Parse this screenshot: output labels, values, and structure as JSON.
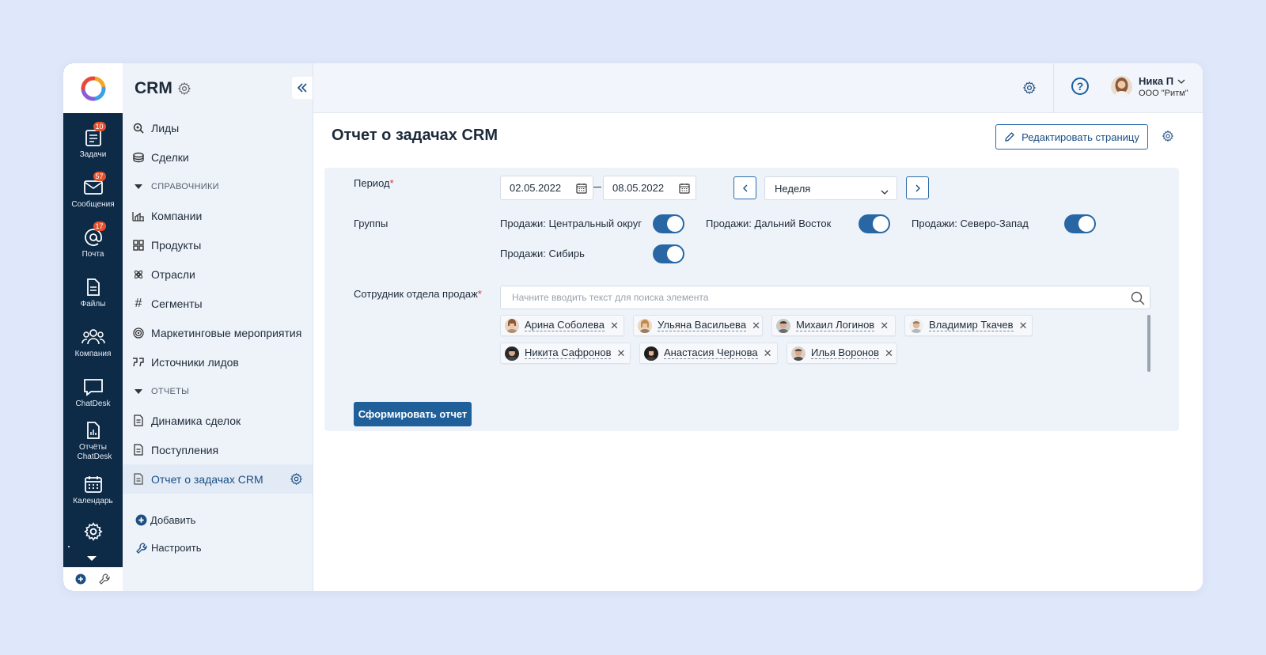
{
  "rail": {
    "items": [
      {
        "label": "Задачи",
        "icon": "tasks-icon",
        "badge": "10"
      },
      {
        "label": "Сообщения",
        "icon": "messages-icon",
        "badge": "57"
      },
      {
        "label": "Почта",
        "icon": "mail-icon",
        "badge": "17"
      },
      {
        "label": "Файлы",
        "icon": "files-icon",
        "badge": ""
      },
      {
        "label": "Компания",
        "icon": "company-icon",
        "badge": ""
      },
      {
        "label": "ChatDesk",
        "icon": "chat-icon",
        "badge": ""
      },
      {
        "label": "Отчёты ChatDesk",
        "icon": "reports-icon",
        "badge": ""
      },
      {
        "label": "Календарь",
        "icon": "calendar-icon",
        "badge": ""
      }
    ]
  },
  "sidebar": {
    "title": "CRM",
    "items": [
      {
        "label": "Лиды",
        "icon": "leads-icon"
      },
      {
        "label": "Сделки",
        "icon": "deals-icon"
      }
    ],
    "section_refs": "СПРАВОЧНИКИ",
    "refs": [
      {
        "label": "Компании",
        "icon": "companies-icon"
      },
      {
        "label": "Продукты",
        "icon": "products-icon"
      },
      {
        "label": "Отрасли",
        "icon": "industries-icon"
      },
      {
        "label": "Сегменты",
        "icon": "hash-icon"
      },
      {
        "label": "Маркетинговые мероприятия",
        "icon": "target-icon"
      },
      {
        "label": "Источники лидов",
        "icon": "quote-icon"
      }
    ],
    "section_reports": "ОТЧЕТЫ",
    "reports": [
      {
        "label": "Динамика сделок",
        "icon": "document-icon"
      },
      {
        "label": "Поступления",
        "icon": "document-icon"
      },
      {
        "label": "Отчет о задачах CRM",
        "icon": "document-icon",
        "active": true
      }
    ],
    "add_label": "Добавить",
    "configure_label": "Настроить"
  },
  "topbar": {
    "user_name": "Ника П",
    "user_org": "ООО \"Ритм\""
  },
  "page": {
    "title": "Отчет о задачах CRM",
    "edit_label": "Редактировать страницу"
  },
  "form": {
    "period_label": "Период",
    "date_from": "02.05.2022",
    "date_to": "08.05.2022",
    "period_select": "Неделя",
    "groups_label": "Группы",
    "groups": [
      {
        "label": "Продажи: Центральный округ",
        "on": true
      },
      {
        "label": "Продажи: Дальний Восток",
        "on": true
      },
      {
        "label": "Продажи: Северо-Запад",
        "on": true
      },
      {
        "label": "Продажи: Сибирь",
        "on": true
      }
    ],
    "employee_label": "Сотрудник отдела продаж",
    "search_placeholder": "Начните вводить текст для поиска элемента",
    "chips": [
      "Арина Соболева",
      "Ульяна Васильева",
      "Михаил Логинов",
      "Владимир Ткачев",
      "Никита Сафронов",
      "Анастасия Чернова",
      "Илья Воронов"
    ],
    "submit_label": "Сформировать отчет"
  },
  "colors": {
    "rail_bg": "#0d2a47",
    "accent": "#1f5f9a",
    "badge": "#e4512c",
    "panel_bg": "#eef3fa",
    "page_bg": "#dfe8fa"
  }
}
